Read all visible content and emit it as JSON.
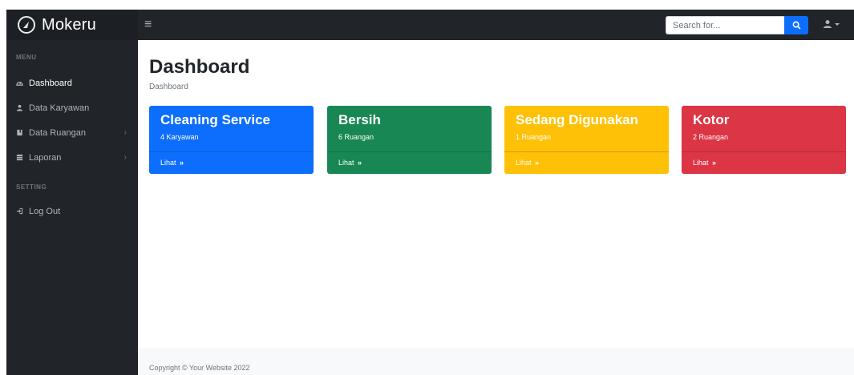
{
  "brand": {
    "name": "Mokeru"
  },
  "navbar": {
    "toggle_glyph": "≡",
    "search_placeholder": "Search for...",
    "search_value": ""
  },
  "sidebar": {
    "menu_heading": "MENU",
    "items": [
      {
        "label": "Dashboard",
        "icon": "dashboard-icon",
        "active": true,
        "has_arrow": false
      },
      {
        "label": "Data Karyawan",
        "icon": "users-icon",
        "active": false,
        "has_arrow": false
      },
      {
        "label": "Data Ruangan",
        "icon": "book-icon",
        "active": false,
        "has_arrow": true
      },
      {
        "label": "Laporan",
        "icon": "table-icon",
        "active": false,
        "has_arrow": true
      }
    ],
    "setting_heading": "SETTING",
    "logout_label": "Log Out",
    "arrow_glyph": "›"
  },
  "main": {
    "title": "Dashboard",
    "breadcrumb": "Dashboard",
    "cards": [
      {
        "title": "Cleaning Service",
        "subtitle": "4 Karyawan",
        "link": "Lihat",
        "color": "#0d6efd"
      },
      {
        "title": "Bersih",
        "subtitle": "6 Ruangan",
        "link": "Lihat",
        "color": "#198754"
      },
      {
        "title": "Sedang Digunakan",
        "subtitle": "1 Ruangan",
        "link": "Lihat",
        "color": "#ffc107"
      },
      {
        "title": "Kotor",
        "subtitle": "2 Ruangan",
        "link": "Lihat",
        "color": "#dc3545"
      }
    ],
    "link_chevron": "»"
  },
  "footer": {
    "copyright": "Copyright © Your Website 2022"
  }
}
